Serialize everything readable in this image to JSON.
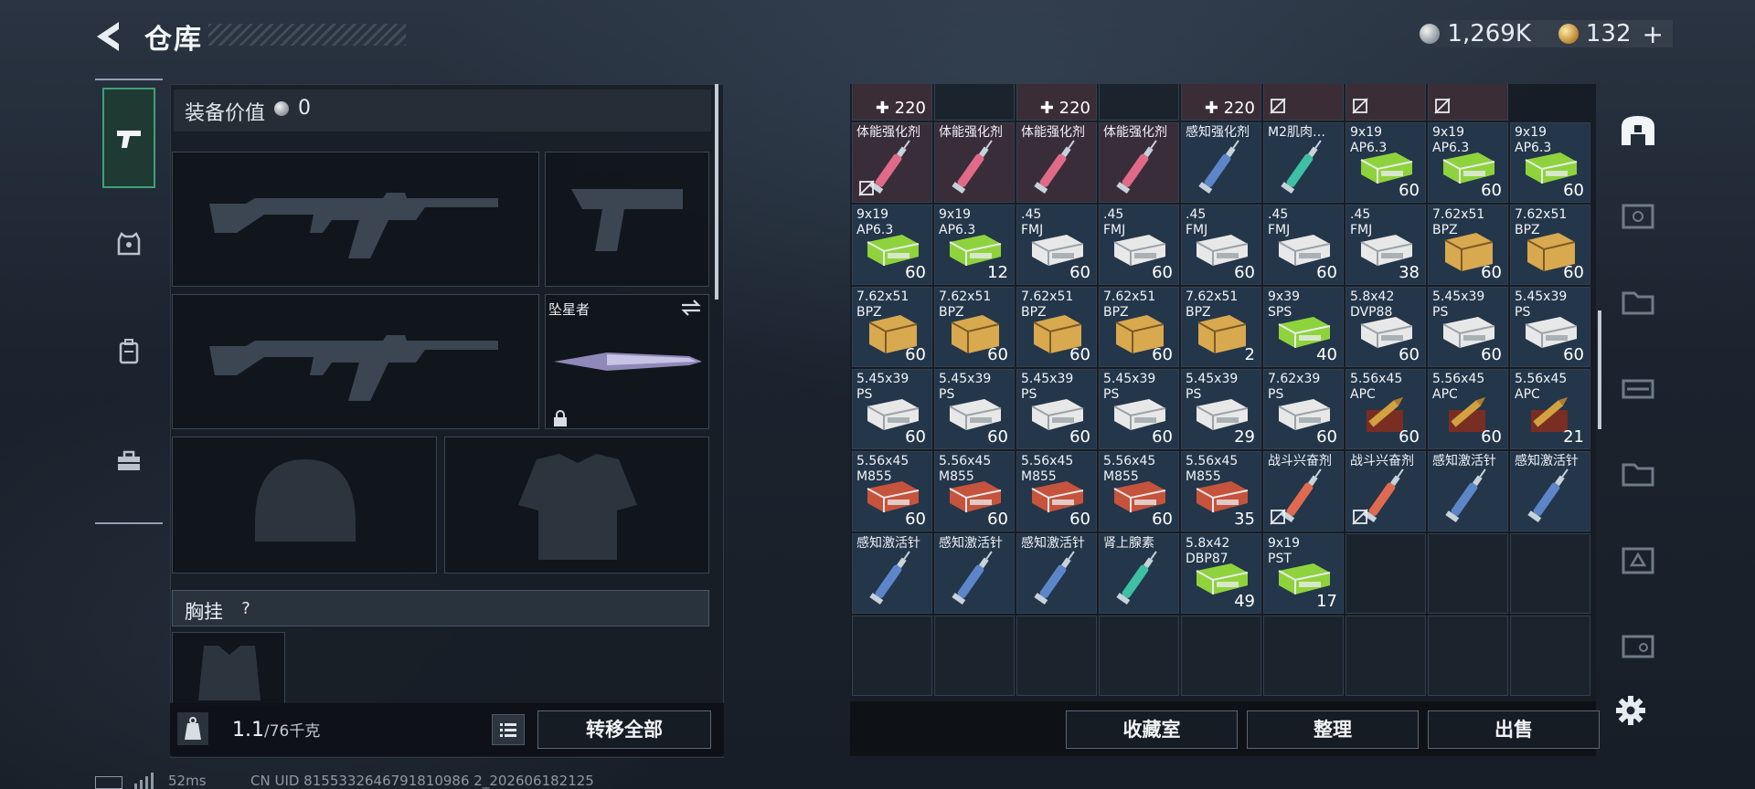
{
  "header": {
    "title": "仓库",
    "silver_amount": "1,269K",
    "gold_amount": "132",
    "plus": "+"
  },
  "equipment": {
    "value_label": "装备价值",
    "value": "0",
    "melee_name": "坠星者",
    "rig_label": "胸挂",
    "rig_help": "?",
    "weight_value": "1.1",
    "weight_capacity": "/76千克",
    "transfer_all": "转移全部"
  },
  "stash": {
    "buttons": {
      "collection": "收藏室",
      "sort": "整理",
      "sell": "出售"
    },
    "rows": [
      [
        {
          "n": "",
          "q": "220",
          "t": "med",
          "plus": true
        },
        {
          "n": "",
          "q": "",
          "t": "empty"
        },
        {
          "n": "",
          "q": "220",
          "t": "med",
          "plus": true
        },
        {
          "n": "",
          "q": "",
          "t": "empty"
        },
        {
          "n": "",
          "q": "220",
          "t": "med",
          "plus": true
        },
        {
          "n": "",
          "q": "",
          "t": "mednosale"
        },
        {
          "n": "",
          "q": "",
          "t": "mednosale"
        },
        {
          "n": "",
          "q": "",
          "t": "mednosale"
        }
      ],
      [
        {
          "n": "体能强化剂",
          "q": "",
          "t": "syr_red",
          "ns": true
        },
        {
          "n": "体能强化剂",
          "q": "",
          "t": "syr_red"
        },
        {
          "n": "体能强化剂",
          "q": "",
          "t": "syr_red"
        },
        {
          "n": "体能强化剂",
          "q": "",
          "t": "syr_red"
        },
        {
          "n": "感知强化剂",
          "q": "",
          "t": "syr_blue"
        },
        {
          "n": "M2肌肉…",
          "q": "",
          "t": "syr_teal"
        },
        {
          "n": "9x19\nAP6.3",
          "q": "60",
          "t": "ammo_green"
        },
        {
          "n": "9x19\nAP6.3",
          "q": "60",
          "t": "ammo_green"
        },
        {
          "n": "9x19\nAP6.3",
          "q": "60",
          "t": "ammo_green"
        }
      ],
      [
        {
          "n": "9x19\nAP6.3",
          "q": "60",
          "t": "ammo_green"
        },
        {
          "n": "9x19\nAP6.3",
          "q": "12",
          "t": "ammo_green"
        },
        {
          "n": ".45\nFMJ",
          "q": "60",
          "t": "ammo_white"
        },
        {
          "n": ".45\nFMJ",
          "q": "60",
          "t": "ammo_white"
        },
        {
          "n": ".45\nFMJ",
          "q": "60",
          "t": "ammo_white"
        },
        {
          "n": ".45\nFMJ",
          "q": "60",
          "t": "ammo_white"
        },
        {
          "n": ".45\nFMJ",
          "q": "38",
          "t": "ammo_white"
        },
        {
          "n": "7.62x51\nBPZ",
          "q": "60",
          "t": "ammo_box"
        },
        {
          "n": "7.62x51\nBPZ",
          "q": "60",
          "t": "ammo_box"
        }
      ],
      [
        {
          "n": "7.62x51\nBPZ",
          "q": "60",
          "t": "ammo_box"
        },
        {
          "n": "7.62x51\nBPZ",
          "q": "60",
          "t": "ammo_box"
        },
        {
          "n": "7.62x51\nBPZ",
          "q": "60",
          "t": "ammo_box"
        },
        {
          "n": "7.62x51\nBPZ",
          "q": "60",
          "t": "ammo_box"
        },
        {
          "n": "7.62x51\nBPZ",
          "q": "2",
          "t": "ammo_box"
        },
        {
          "n": "9x39\nSPS",
          "q": "40",
          "t": "ammo_green"
        },
        {
          "n": "5.8x42\nDVP88",
          "q": "60",
          "t": "ammo_white"
        },
        {
          "n": "5.45x39\nPS",
          "q": "60",
          "t": "ammo_white"
        },
        {
          "n": "5.45x39\nPS",
          "q": "60",
          "t": "ammo_white"
        }
      ],
      [
        {
          "n": "5.45x39\nPS",
          "q": "60",
          "t": "ammo_white"
        },
        {
          "n": "5.45x39\nPS",
          "q": "60",
          "t": "ammo_white"
        },
        {
          "n": "5.45x39\nPS",
          "q": "60",
          "t": "ammo_white"
        },
        {
          "n": "5.45x39\nPS",
          "q": "60",
          "t": "ammo_white"
        },
        {
          "n": "5.45x39\nPS",
          "q": "29",
          "t": "ammo_white"
        },
        {
          "n": "7.62x39\nPS",
          "q": "60",
          "t": "ammo_white"
        },
        {
          "n": "5.56x45\nAPC",
          "q": "60",
          "t": "ammo_bullet"
        },
        {
          "n": "5.56x45\nAPC",
          "q": "60",
          "t": "ammo_bullet"
        },
        {
          "n": "5.56x45\nAPC",
          "q": "21",
          "t": "ammo_bullet"
        }
      ],
      [
        {
          "n": "5.56x45\nM855",
          "q": "60",
          "t": "ammo_red"
        },
        {
          "n": "5.56x45\nM855",
          "q": "60",
          "t": "ammo_red"
        },
        {
          "n": "5.56x45\nM855",
          "q": "60",
          "t": "ammo_red"
        },
        {
          "n": "5.56x45\nM855",
          "q": "60",
          "t": "ammo_red"
        },
        {
          "n": "5.56x45\nM855",
          "q": "35",
          "t": "ammo_red"
        },
        {
          "n": "战斗兴奋剂",
          "q": "",
          "t": "syr_orange",
          "ns": true
        },
        {
          "n": "战斗兴奋剂",
          "q": "",
          "t": "syr_orange",
          "ns": true
        },
        {
          "n": "感知激活针",
          "q": "",
          "t": "syr_blue"
        },
        {
          "n": "感知激活针",
          "q": "",
          "t": "syr_blue"
        }
      ],
      [
        {
          "n": "感知激活针",
          "q": "",
          "t": "syr_blue"
        },
        {
          "n": "感知激活针",
          "q": "",
          "t": "syr_blue"
        },
        {
          "n": "感知激活针",
          "q": "",
          "t": "syr_blue"
        },
        {
          "n": "肾上腺素",
          "q": "",
          "t": "syr_teal"
        },
        {
          "n": "5.8x42\nDBP87",
          "q": "49",
          "t": "ammo_green"
        },
        {
          "n": "9x19\nPST",
          "q": "17",
          "t": "ammo_green"
        },
        {
          "n": "",
          "q": "",
          "t": "empty"
        },
        {
          "n": "",
          "q": "",
          "t": "empty"
        },
        {
          "n": "",
          "q": "",
          "t": "empty"
        }
      ],
      [
        {
          "n": "",
          "q": "",
          "t": "empty"
        },
        {
          "n": "",
          "q": "",
          "t": "empty"
        },
        {
          "n": "",
          "q": "",
          "t": "empty"
        },
        {
          "n": "",
          "q": "",
          "t": "empty"
        },
        {
          "n": "",
          "q": "",
          "t": "empty"
        },
        {
          "n": "",
          "q": "",
          "t": "empty"
        },
        {
          "n": "",
          "q": "",
          "t": "empty"
        },
        {
          "n": "",
          "q": "",
          "t": "empty"
        },
        {
          "n": "",
          "q": "",
          "t": "empty"
        }
      ]
    ]
  },
  "status": {
    "ping": "52ms",
    "uid": "CN UID 8155332646791810986 2_202606182125"
  },
  "colors": {
    "accent_green": "#3fa07a",
    "panel": "#181e26"
  }
}
